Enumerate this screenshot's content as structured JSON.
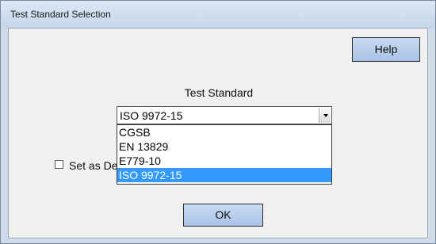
{
  "window": {
    "title": "Test Standard Selection"
  },
  "help_button": {
    "label": "Help"
  },
  "test_standard": {
    "label": "Test Standard",
    "selected": "ISO 9972-15",
    "options": [
      "CGSB",
      "EN 13829",
      "E779-10",
      "ISO 9972-15"
    ]
  },
  "default_checkbox": {
    "label": "Set as Default",
    "checked": false
  },
  "ok_button": {
    "label": "OK"
  },
  "colors": {
    "selection_highlight": "#3399ff",
    "button_face": "#b8cfee"
  }
}
